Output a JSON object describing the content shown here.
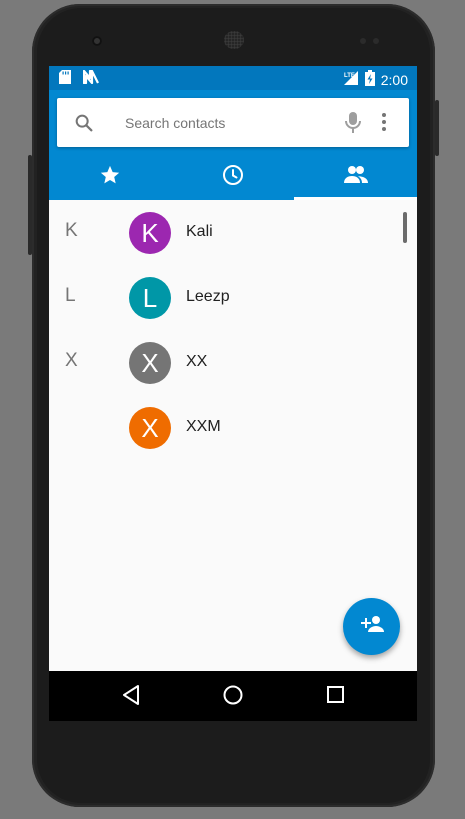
{
  "status_bar": {
    "left_icons": [
      "sd-card-icon",
      "n-notification-icon"
    ],
    "network": "LTE",
    "battery": "charging",
    "time": "2:00",
    "color": "#0277bd"
  },
  "search": {
    "placeholder": "Search contacts",
    "value": ""
  },
  "tabs": [
    {
      "name": "favorites",
      "icon": "star-icon",
      "selected": false
    },
    {
      "name": "recents",
      "icon": "clock-icon",
      "selected": false
    },
    {
      "name": "contacts",
      "icon": "people-icon",
      "selected": true
    }
  ],
  "contacts": [
    {
      "section": "K",
      "initial": "K",
      "name": "Kali",
      "color": "#9c27b0"
    },
    {
      "section": "L",
      "initial": "L",
      "name": "Leezp",
      "color": "#0097a7"
    },
    {
      "section": "X",
      "initial": "X",
      "name": "XX",
      "color": "#757575"
    },
    {
      "section": "",
      "initial": "X",
      "name": "XXM",
      "color": "#ef6c00"
    }
  ],
  "fab": {
    "icon": "add-person-icon"
  },
  "colors": {
    "accent": "#0288d1",
    "background": "#fafafa"
  },
  "navbar": {
    "buttons": [
      "back-icon",
      "home-icon",
      "recents-icon"
    ]
  }
}
